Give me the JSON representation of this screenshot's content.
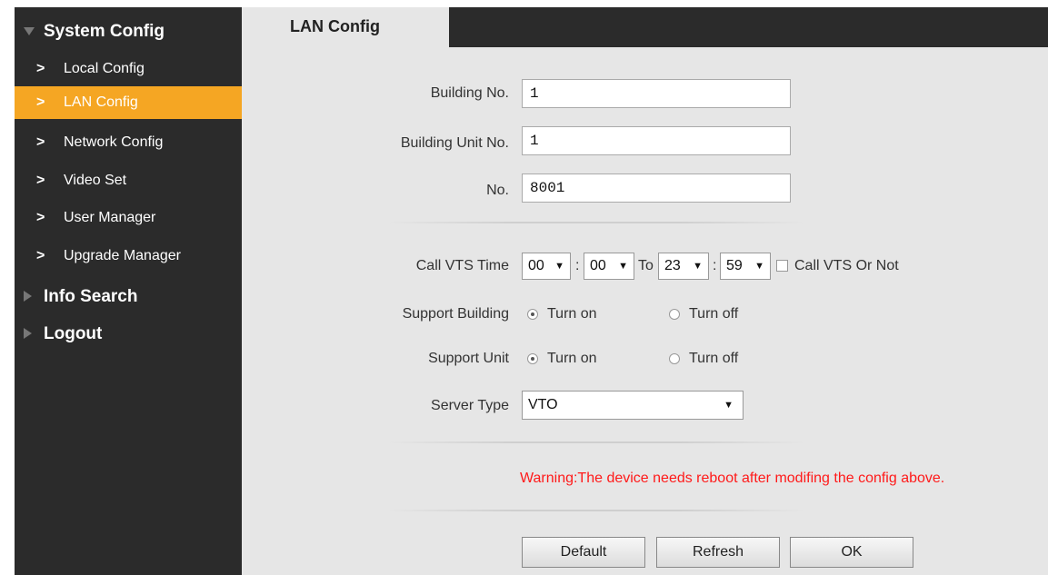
{
  "sidebar": {
    "groups": [
      {
        "label": "System Config"
      },
      {
        "label": "Info Search"
      },
      {
        "label": "Logout"
      }
    ],
    "items": [
      {
        "label": "Local Config"
      },
      {
        "label": "LAN Config"
      },
      {
        "label": "Network Config"
      },
      {
        "label": "Video Set"
      },
      {
        "label": "User Manager"
      },
      {
        "label": "Upgrade Manager"
      }
    ],
    "active_item": "LAN Config"
  },
  "tab": {
    "label": "LAN Config"
  },
  "form": {
    "building_no": {
      "label": "Building No.",
      "value": "1"
    },
    "building_unit_no": {
      "label": "Building Unit No.",
      "value": "1"
    },
    "no": {
      "label": "No.",
      "value": "8001"
    },
    "call_vts_time": {
      "label": "Call VTS Time",
      "start_hour": "00",
      "start_min": "00",
      "to_label": "To",
      "end_hour": "23",
      "end_min": "59",
      "colon": ":",
      "checkbox_label": "Call VTS Or Not",
      "checkbox_checked": false
    },
    "support_building": {
      "label": "Support Building",
      "on_label": "Turn on",
      "off_label": "Turn off",
      "selected": "on"
    },
    "support_unit": {
      "label": "Support Unit",
      "on_label": "Turn on",
      "off_label": "Turn off",
      "selected": "on"
    },
    "server_type": {
      "label": "Server Type",
      "value": "VTO"
    },
    "dropdown_arrow": "▼"
  },
  "warning": "Warning:The device needs reboot after modifing the config above.",
  "buttons": {
    "default": "Default",
    "refresh": "Refresh",
    "ok": "OK"
  },
  "colors": {
    "sidebar_bg": "#2b2b2b",
    "active_bg": "#f5a623",
    "content_bg": "#e6e6e6",
    "warning": "#ff1a1a"
  }
}
